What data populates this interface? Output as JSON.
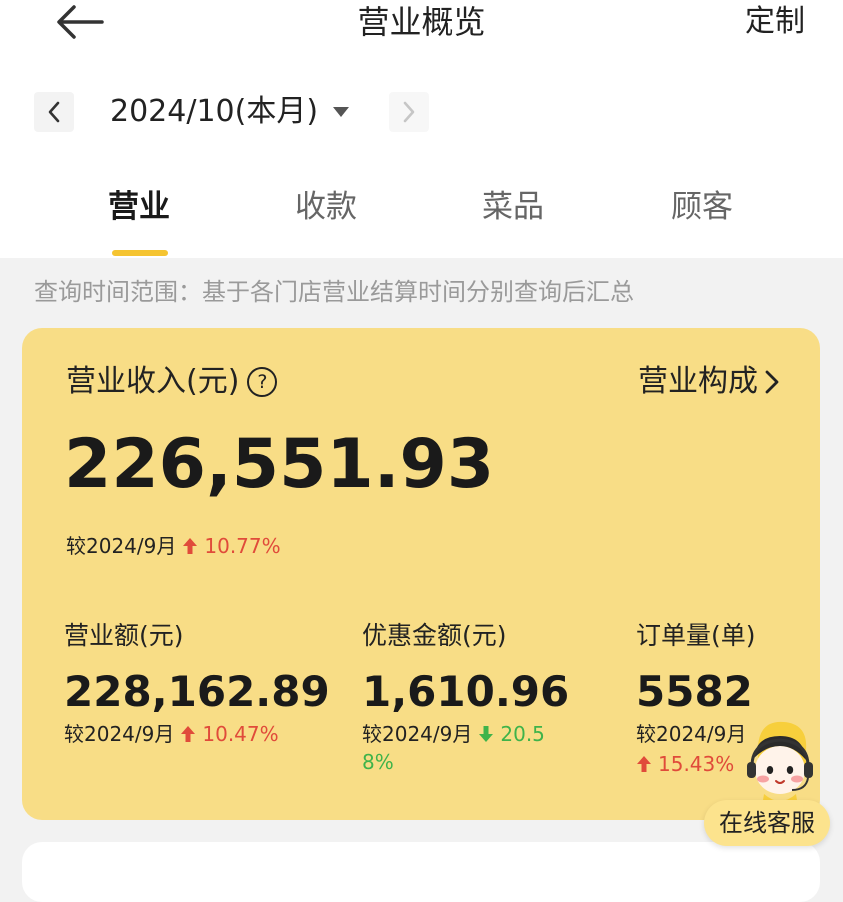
{
  "header": {
    "title": "营业概览",
    "customize_label": "定制"
  },
  "period": {
    "selected": "2024/10(本月)"
  },
  "tabs": [
    {
      "label": "营业",
      "active": true
    },
    {
      "label": "收款",
      "active": false
    },
    {
      "label": "菜品",
      "active": false
    },
    {
      "label": "顾客",
      "active": false
    }
  ],
  "range_note": "查询时间范围：基于各门店营业结算时间分别查询后汇总",
  "summary": {
    "income_label": "营业收入(元)",
    "breakdown_label": "营业构成",
    "income_value": "226,551.93",
    "compare_label": "较2024/9月",
    "compare_pct": "10.77%",
    "compare_direction": "up"
  },
  "metrics": [
    {
      "label": "营业额(元)",
      "value": "228,162.89",
      "compare_label": "较2024/9月",
      "compare_pct": "10.47%",
      "direction": "up"
    },
    {
      "label": "优惠金额(元)",
      "value": "1,610.96",
      "compare_label": "较2024/9月",
      "compare_pct": "20.58%",
      "compare_pct_line1": "20.5",
      "compare_pct_line2": "8%",
      "direction": "down"
    },
    {
      "label": "订单量(单)",
      "value": "5582",
      "compare_label": "较2024/9月",
      "compare_pct": "15.43%",
      "direction": "up"
    }
  ],
  "service": {
    "label": "在线客服"
  },
  "colors": {
    "accent_yellow": "#f5c431",
    "card_yellow": "#f8dd86",
    "up_red": "#e04b3a",
    "down_green": "#3fb34a",
    "page_bg": "#f2f2f2"
  },
  "icons": {
    "back": "back-arrow-icon",
    "prev": "chevron-left-icon",
    "next": "chevron-right-icon",
    "dropdown": "caret-down-icon",
    "help": "help-circle-icon",
    "breakdown": "chevron-right-icon",
    "up": "arrow-up-icon",
    "down": "arrow-down-icon",
    "service": "customer-service-avatar-icon"
  }
}
